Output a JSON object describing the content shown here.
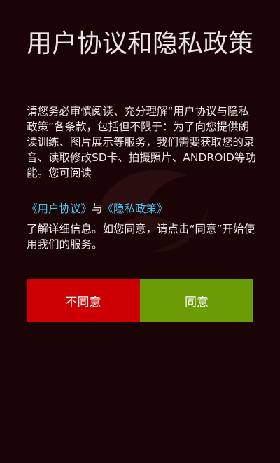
{
  "dialog": {
    "title": "用户协议和隐私政策",
    "description": "请您务必审慎阅读、充分理解“用户协议与隐私政策”各条款，包括但不限于：为了向您提供朗读训练、图片展示等服务，我们需要获取您的录音、读取修改SD卡、拍摄照片、ANDROID等功能。您可阅读",
    "user_agreement_link": "《用户协议》",
    "conjunction": "与",
    "privacy_policy_link": "《隐私政策》",
    "detail_text": "了解详细信息。如您同意，请点击“同意”开始使用我们的服务。"
  },
  "buttons": {
    "disagree_label": "不同意",
    "agree_label": "同意"
  },
  "colors": {
    "background": "#1b0405",
    "link": "#4fc2f0",
    "disagree": "#cc0003",
    "agree": "#6b9c05"
  },
  "icons": {
    "background_watermark": "app-logo-watermark"
  }
}
